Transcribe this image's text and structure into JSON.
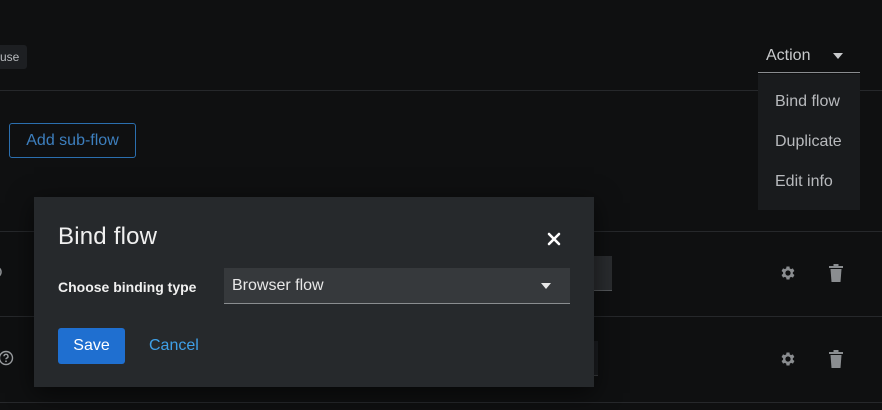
{
  "background": {
    "badge_text": "use",
    "subflow_button_label": "Add sub-flow",
    "action_dropdown": {
      "label": "Action",
      "items": [
        "Bind flow",
        "Duplicate",
        "Edit info"
      ]
    }
  },
  "modal": {
    "title": "Bind flow",
    "field_label": "Choose binding type",
    "select_value": "Browser flow",
    "save_label": "Save",
    "cancel_label": "Cancel"
  },
  "colors": {
    "primary": "#1f6fd0",
    "link": "#3fa0e8",
    "modal_bg": "#26292c",
    "page_bg": "#0f1011"
  }
}
